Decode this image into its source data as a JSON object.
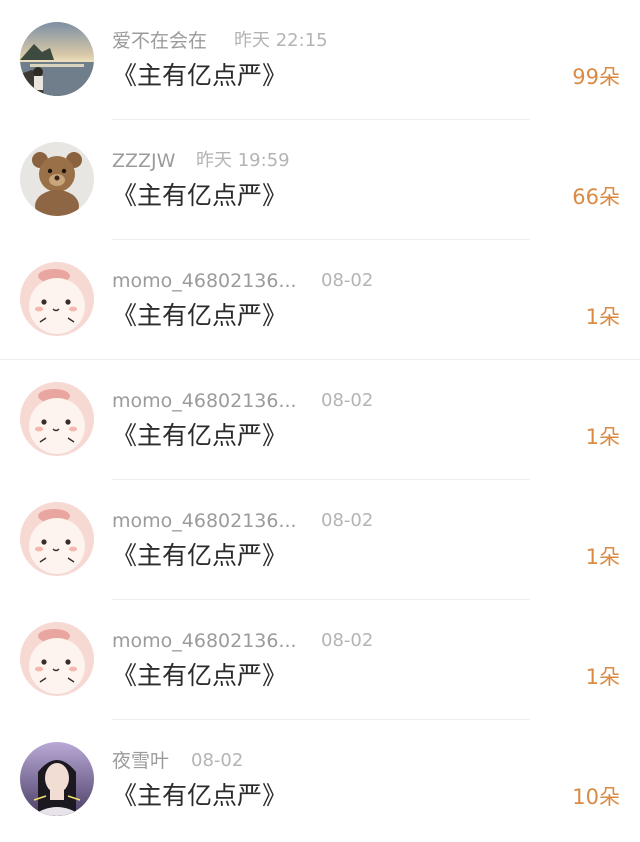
{
  "colors": {
    "accent": "#d98a45",
    "name_text": "#9b9b9b",
    "title_text": "#2b2b2b",
    "divider": "#efefef"
  },
  "rows": [
    {
      "name": "爱不在会在",
      "time": "昨天 22:15",
      "title": "《主有亿点严》",
      "count": "99朵",
      "avatar_icon": "sunset-lake-avatar-icon"
    },
    {
      "name": "ZZZJW",
      "time": "昨天 19:59",
      "title": "《主有亿点严》",
      "count": "66朵",
      "avatar_icon": "teddy-bear-avatar-icon"
    },
    {
      "name": "momo_46802136...",
      "time": "08-02",
      "title": "《主有亿点严》",
      "count": "1朵",
      "avatar_icon": "pink-momo-avatar-icon"
    },
    {
      "name": "momo_46802136...",
      "time": "08-02",
      "title": "《主有亿点严》",
      "count": "1朵",
      "avatar_icon": "pink-momo-avatar-icon"
    },
    {
      "name": "momo_46802136...",
      "time": "08-02",
      "title": "《主有亿点严》",
      "count": "1朵",
      "avatar_icon": "pink-momo-avatar-icon"
    },
    {
      "name": "momo_46802136...",
      "time": "08-02",
      "title": "《主有亿点严》",
      "count": "1朵",
      "avatar_icon": "pink-momo-avatar-icon"
    },
    {
      "name": "夜雪叶",
      "time": "08-02",
      "title": "《主有亿点严》",
      "count": "10朵",
      "avatar_icon": "girl-portrait-avatar-icon"
    }
  ]
}
